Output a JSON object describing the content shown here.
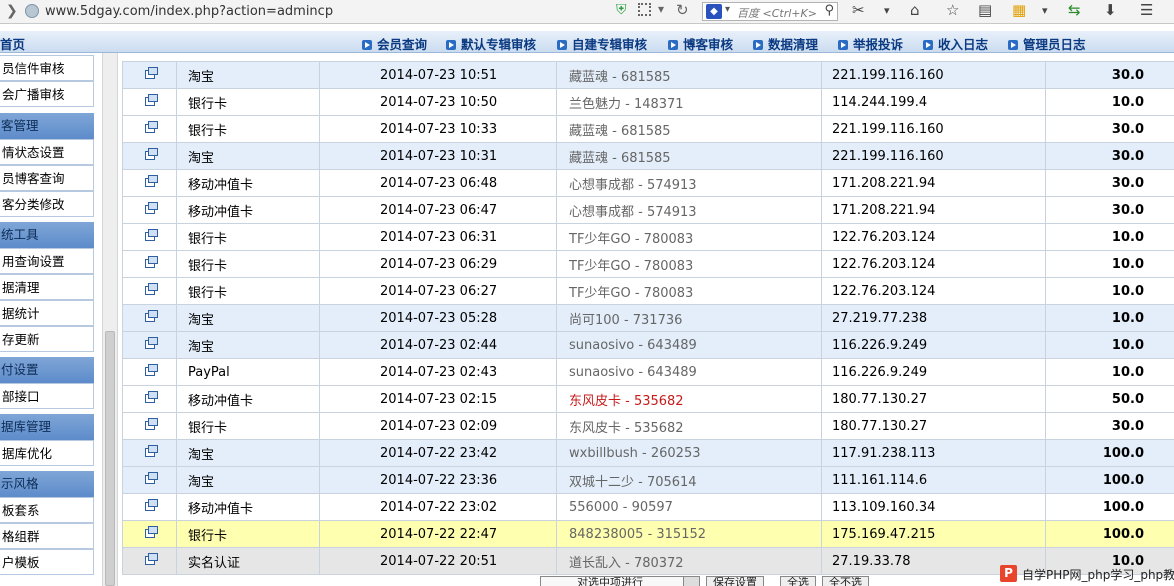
{
  "browser": {
    "url": "www.5dgay.com/index.php?action=admincp",
    "search_placeholder": "百度 <Ctrl+K>"
  },
  "topnav": {
    "home": "首页",
    "links": [
      "会员查询",
      "默认专辑审核",
      "自建专辑审核",
      "博客审核",
      "数据清理",
      "举报投诉",
      "收入日志",
      "管理员日志"
    ]
  },
  "sidebar": {
    "entries": [
      {
        "kind": "item",
        "label": "员信件审核"
      },
      {
        "kind": "item",
        "label": "会广播审核"
      },
      {
        "kind": "head",
        "label": "客管理"
      },
      {
        "kind": "item",
        "label": "情状态设置"
      },
      {
        "kind": "item",
        "label": "员博客查询"
      },
      {
        "kind": "item",
        "label": "客分类修改"
      },
      {
        "kind": "head",
        "label": "统工具"
      },
      {
        "kind": "item",
        "label": "用查询设置"
      },
      {
        "kind": "item",
        "label": "据清理"
      },
      {
        "kind": "item",
        "label": "据统计"
      },
      {
        "kind": "item",
        "label": "存更新"
      },
      {
        "kind": "head",
        "label": "付设置"
      },
      {
        "kind": "item",
        "label": "部接口"
      },
      {
        "kind": "head",
        "label": "据库管理"
      },
      {
        "kind": "item",
        "label": "据库优化"
      },
      {
        "kind": "head",
        "label": "示风格"
      },
      {
        "kind": "item",
        "label": "板套系"
      },
      {
        "kind": "item",
        "label": "格组群"
      },
      {
        "kind": "item",
        "label": "户模板"
      }
    ]
  },
  "rows": [
    {
      "style": "blue",
      "type": "淘宝",
      "time": "2014-07-23 10:51",
      "user": "藏蓝魂 - 681585",
      "ip": "221.199.116.160",
      "amount": "30.0"
    },
    {
      "style": "white",
      "type": "银行卡",
      "time": "2014-07-23 10:50",
      "user": "兰色魅力 - 148371",
      "ip": "114.244.199.4",
      "amount": "10.0"
    },
    {
      "style": "white",
      "type": "银行卡",
      "time": "2014-07-23 10:33",
      "user": "藏蓝魂 - 681585",
      "ip": "221.199.116.160",
      "amount": "30.0"
    },
    {
      "style": "blue",
      "type": "淘宝",
      "time": "2014-07-23 10:31",
      "user": "藏蓝魂 - 681585",
      "ip": "221.199.116.160",
      "amount": "30.0"
    },
    {
      "style": "white",
      "type": "移动冲值卡",
      "time": "2014-07-23 06:48",
      "user": "心想事成都 - 574913",
      "ip": "171.208.221.94",
      "amount": "30.0"
    },
    {
      "style": "white",
      "type": "移动冲值卡",
      "time": "2014-07-23 06:47",
      "user": "心想事成都 - 574913",
      "ip": "171.208.221.94",
      "amount": "30.0"
    },
    {
      "style": "white",
      "type": "银行卡",
      "time": "2014-07-23 06:31",
      "user": "TF少年GO - 780083",
      "ip": "122.76.203.124",
      "amount": "10.0"
    },
    {
      "style": "white",
      "type": "银行卡",
      "time": "2014-07-23 06:29",
      "user": "TF少年GO - 780083",
      "ip": "122.76.203.124",
      "amount": "10.0"
    },
    {
      "style": "white",
      "type": "银行卡",
      "time": "2014-07-23 06:27",
      "user": "TF少年GO - 780083",
      "ip": "122.76.203.124",
      "amount": "10.0"
    },
    {
      "style": "blue",
      "type": "淘宝",
      "time": "2014-07-23 05:28",
      "user": "尚可100 - 731736",
      "ip": "27.219.77.238",
      "amount": "10.0"
    },
    {
      "style": "blue",
      "type": "淘宝",
      "time": "2014-07-23 02:44",
      "user": "sunaosivo - 643489",
      "ip": "116.226.9.249",
      "amount": "10.0"
    },
    {
      "style": "white",
      "type": "PayPal",
      "time": "2014-07-23 02:43",
      "user": "sunaosivo - 643489",
      "ip": "116.226.9.249",
      "amount": "10.0"
    },
    {
      "style": "white",
      "type": "移动冲值卡",
      "time": "2014-07-23 02:15",
      "user": "东风皮卡 - 535682",
      "ip": "180.77.130.27",
      "amount": "50.0",
      "red": true
    },
    {
      "style": "white",
      "type": "银行卡",
      "time": "2014-07-23 02:09",
      "user": "东风皮卡 - 535682",
      "ip": "180.77.130.27",
      "amount": "30.0"
    },
    {
      "style": "blue",
      "type": "淘宝",
      "time": "2014-07-22 23:42",
      "user": "wxbillbush - 260253",
      "ip": "117.91.238.113",
      "amount": "100.0"
    },
    {
      "style": "blue",
      "type": "淘宝",
      "time": "2014-07-22 23:36",
      "user": "双城十二少 - 705614",
      "ip": "111.161.114.6",
      "amount": "100.0"
    },
    {
      "style": "white",
      "type": "移动冲值卡",
      "time": "2014-07-22 23:02",
      "user": "556000 - 90597",
      "ip": "113.109.160.34",
      "amount": "100.0"
    },
    {
      "style": "yellow",
      "type": "银行卡",
      "time": "2014-07-22 22:47",
      "user": "848238005 - 315152",
      "ip": "175.169.47.215",
      "amount": "100.0"
    },
    {
      "style": "grey",
      "type": "实名认证",
      "time": "2014-07-22 20:51",
      "user": "道长乱入 - 780372",
      "ip": "27.19.33.78",
      "amount": "10.0"
    }
  ],
  "bottom": {
    "select_text": "对选中项进行",
    "buttons": [
      "保存设置",
      "全选",
      "全不选"
    ]
  },
  "watermark": {
    "logo": "P",
    "text": "自学PHP网_php学习_php教程"
  },
  "colors": {
    "nav_text": "#0b3a82",
    "row_blue": "#e3eefa",
    "row_yellow": "#ffffb0",
    "user_red": "#c81a1a"
  }
}
